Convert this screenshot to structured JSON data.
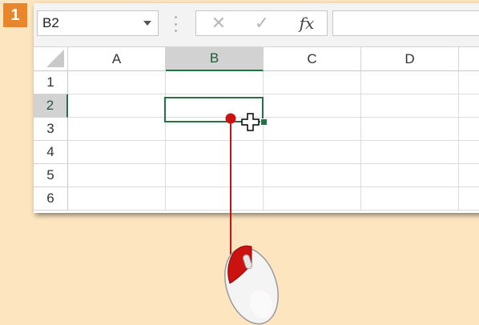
{
  "step": {
    "number": "1"
  },
  "formula_bar": {
    "name_box_value": "B2",
    "cancel_symbol": "✕",
    "enter_symbol": "✓",
    "function_symbol": "fx",
    "formula_value": ""
  },
  "columns": [
    "A",
    "B",
    "C",
    "D"
  ],
  "rows": [
    "1",
    "2",
    "3",
    "4",
    "5",
    "6"
  ],
  "active_cell": {
    "column": "B",
    "row": "2"
  },
  "colors": {
    "background": "#fde5c0",
    "badge": "#e8862b",
    "excel_green": "#217346",
    "pointer_red": "#cc1111"
  },
  "icons": {
    "cursor": "cross-cursor-icon",
    "mouse": "mouse-left-click-icon"
  }
}
